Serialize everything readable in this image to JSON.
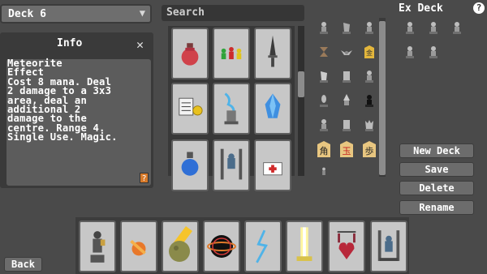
{
  "deck_select": {
    "value": "Deck 6",
    "icon": "chevron-down-icon"
  },
  "info": {
    "title": "Info",
    "close_icon": "close-icon",
    "text": "Meteorite\nEffect\nCost 8 mana. Deal\n2 damage to a 3x3\narea, deal an\nadditional 2\ndamage to the\ncentre. Range 4.\nSingle Use. Magic.",
    "help_label": "?"
  },
  "search": {
    "placeholder": "Search"
  },
  "grid_cards": [
    {
      "icon": "red-potion-icon"
    },
    {
      "icon": "colored-pawns-icon"
    },
    {
      "icon": "dagger-icon"
    },
    {
      "icon": "scroll-and-coin-icon"
    },
    {
      "icon": "lightning-statue-icon"
    },
    {
      "icon": "blue-crystal-icon"
    },
    {
      "icon": "blue-potion-icon"
    },
    {
      "icon": "pillar-statue-icon"
    },
    {
      "icon": "medkit-icon"
    }
  ],
  "pieces": [
    "pawn-icon",
    "knight-icon",
    "pawn-icon",
    "hourglass-icon",
    "bat-icon",
    "gold-general-icon",
    "horse-icon",
    "rook-icon",
    "pawn-icon",
    "bishop-icon",
    "wizard-icon",
    "dark-pawn-icon",
    "pawn-icon",
    "rook-icon",
    "queen-icon",
    "kaku-tile-icon",
    "king-tile-icon",
    "fu-tile-icon",
    "small-pawn-icon"
  ],
  "shogi_tiles": [
    "角",
    "玉",
    "歩"
  ],
  "exdeck": {
    "title": "Ex Deck",
    "help": "?",
    "pieces": [
      "pawn-icon",
      "pawn-icon",
      "pawn-icon",
      "pawn-icon",
      "pawn-icon"
    ]
  },
  "buttons": {
    "new_deck": "New Deck",
    "save": "Save",
    "delete": "Delete",
    "rename": "Rename",
    "back": "Back"
  },
  "hand_cards": [
    {
      "icon": "priest-statue-icon"
    },
    {
      "icon": "fireball-icon"
    },
    {
      "icon": "meteorite-icon"
    },
    {
      "icon": "black-hole-icon"
    },
    {
      "icon": "lightning-icon"
    },
    {
      "icon": "light-beam-icon"
    },
    {
      "icon": "heart-shield-icon"
    },
    {
      "icon": "pillar-statue-icon"
    }
  ],
  "colors": {
    "background": "#4a4a4a",
    "card": "#c7c7c7",
    "panel": "#3a3a3a",
    "button": "#6c6c6c"
  }
}
